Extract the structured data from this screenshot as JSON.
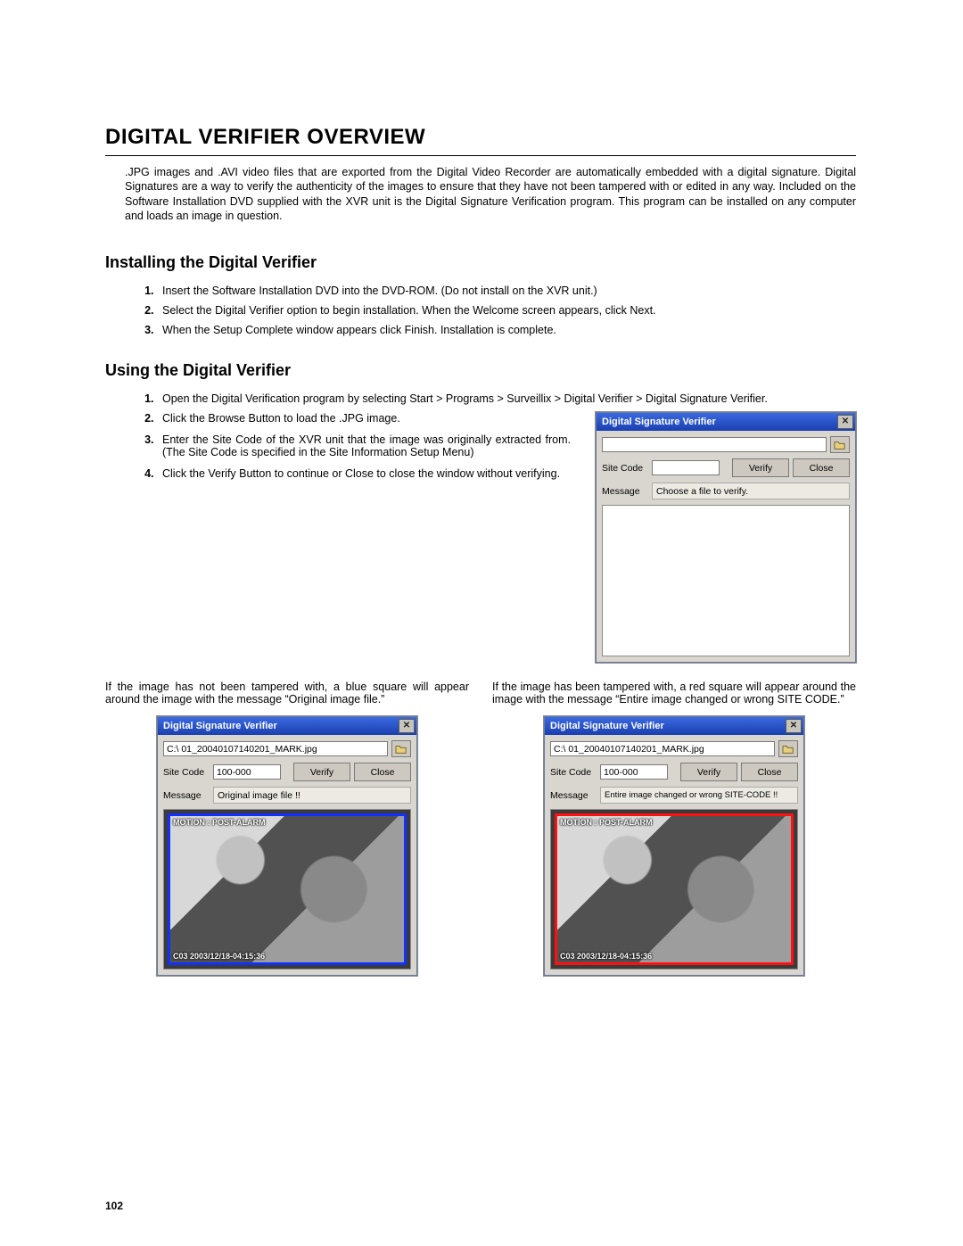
{
  "page": {
    "h1": "DIGITAL VERIFIER OVERVIEW",
    "intro": ".JPG images and .AVI video files that are exported from the Digital Video Recorder are automatically embedded with a digital signature.  Digital Signatures are a way to verify the authenticity of the images to ensure that they have not been tampered with or edited in any way.  Included on the Software Installation DVD supplied with the XVR unit is the Digital Signature Verification program.  This program can be installed on any computer and loads an image in question.",
    "h2_install": "Installing the Digital Verifier",
    "install_steps": [
      "Insert the Software Installation DVD into the DVD-ROM.  (Do not install on the XVR unit.)",
      "Select the Digital Verifier option to begin installation.  When the Welcome screen appears, click Next.",
      "When the Setup Complete window appears click Finish.  Installation is complete."
    ],
    "h2_using": "Using the Digital Verifier",
    "using_steps": [
      "Open the Digital Verification program by selecting Start > Programs > Surveillix > Digital Verifier > Digital Signature Verifier.",
      "Click the Browse Button to load the .JPG image.",
      "Enter the Site Code of the XVR unit that the image was originally extracted from.  (The Site Code is specified in the Site Information Setup Menu)",
      "Click the Verify Button to continue or Close to close the window without verifying."
    ],
    "result_blue": "If the image has not been tampered with, a blue square will appear around the image with the message “Original image file.”",
    "result_red": "If the image has been tampered with, a red square will appear around the image with the message “Entire image changed or wrong SITE CODE.”",
    "page_number": "102"
  },
  "app": {
    "title": "Digital Signature Verifier",
    "labels": {
      "site_code": "Site Code",
      "message": "Message",
      "verify": "Verify",
      "close": "Close"
    },
    "empty": {
      "path": "",
      "site_code": "",
      "message": "Choose a file to verify."
    },
    "blue": {
      "path": "C:\\ 01_20040107140201_MARK.jpg",
      "site_code": "100-000",
      "message": "Original image file !!",
      "overlay_top": "MOTION : POST-ALARM",
      "overlay_bot": "C03 2003/12/18-04:15:36"
    },
    "red": {
      "path": "C:\\ 01_20040107140201_MARK.jpg",
      "site_code": "100-000",
      "message": "Entire image changed or wrong SITE-CODE !!",
      "overlay_top": "MOTION : POST-ALARM",
      "overlay_bot": "C03 2003/12/18-04:15:36"
    }
  }
}
